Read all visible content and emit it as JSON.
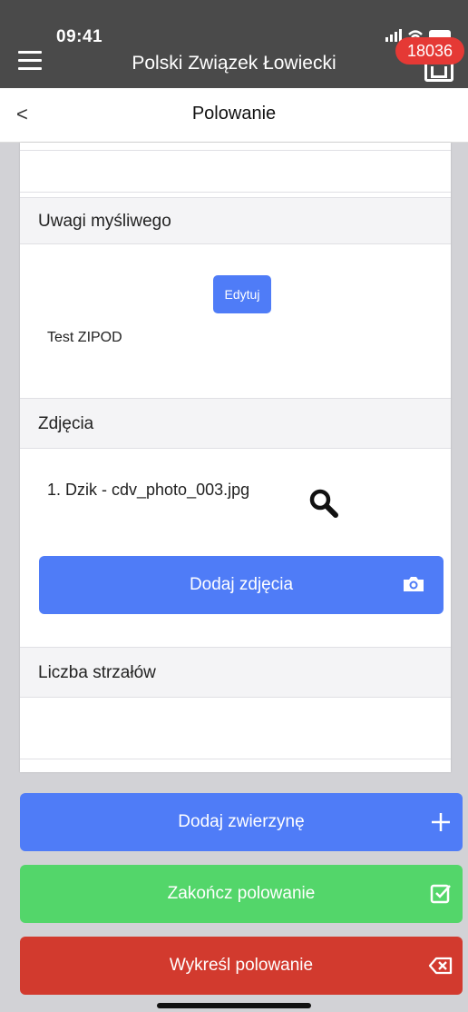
{
  "status_bar": {
    "time": "09:41",
    "icons": "signal wifi battery"
  },
  "app_bar": {
    "title": "Polski Związek Łowiecki",
    "notification_count": "18036",
    "menu_icon": "hamburger-menu-icon",
    "tray_icon": "inbox-tray-icon"
  },
  "sub_header": {
    "back_glyph": "<",
    "title": "Polowanie"
  },
  "sections": {
    "hunter_notes": {
      "heading": "Uwagi myśliwego",
      "edit_label": "Edytuj",
      "note": "Test ZIPOD"
    },
    "photos": {
      "heading": "Zdjęcia",
      "items": [
        "1. Dzik - cdv_photo_003.jpg"
      ],
      "add_label": "Dodaj zdjęcia"
    },
    "shots": {
      "heading": "Liczba strzałów"
    }
  },
  "actions": {
    "add_game": "Dodaj zwierzynę",
    "finish_hunt": "Zakończ polowanie",
    "strike_hunt": "Wykreśl polowanie"
  },
  "colors": {
    "primary": "#4f7cf7",
    "success": "#53d66a",
    "danger": "#d23a2e",
    "badge": "#e53935",
    "app_bar": "#4a4a4a"
  }
}
